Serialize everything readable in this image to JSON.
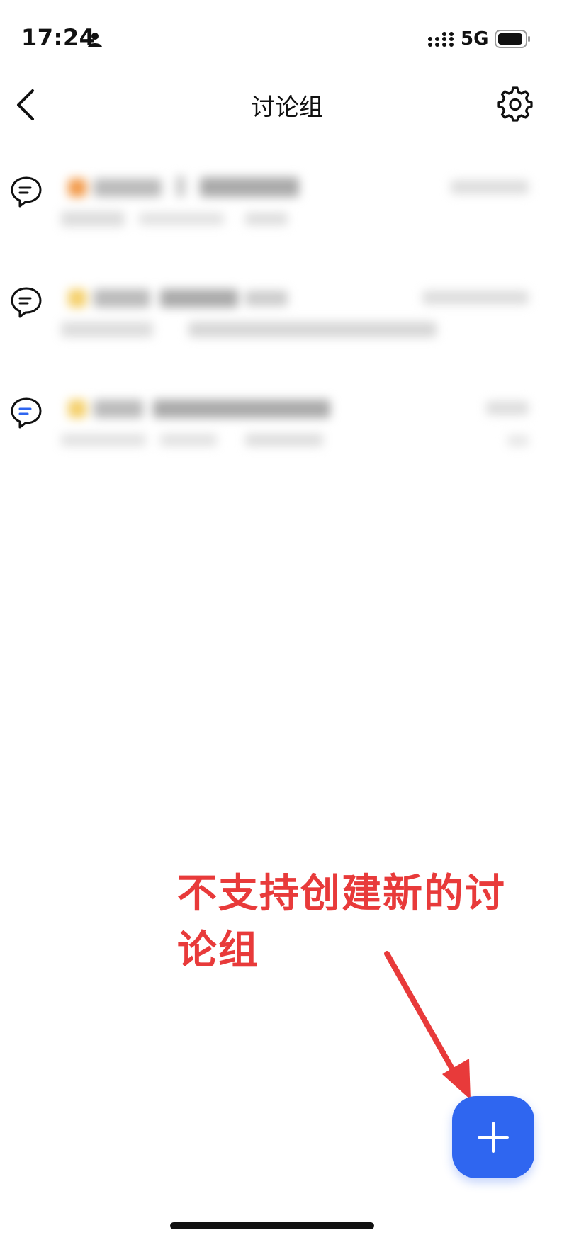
{
  "status_bar": {
    "time": "17:24",
    "network": "5G",
    "icons": [
      "person-icon",
      "signal-icon",
      "battery-icon"
    ]
  },
  "nav": {
    "title": "讨论组",
    "back_icon": "chevron-left-icon",
    "settings_icon": "gear-icon"
  },
  "discussions": [
    {
      "icon": "chat-bubble-icon",
      "accent": "#f29a4a",
      "title": "",
      "time": "",
      "preview": ""
    },
    {
      "icon": "chat-bubble-icon",
      "accent": "#f4cf6a",
      "title": "",
      "time": "",
      "preview": ""
    },
    {
      "icon": "chat-bubble-active-icon",
      "accent": "#f4cf6a",
      "title": "",
      "time": "",
      "preview": ""
    }
  ],
  "annotation": {
    "text": "不支持创建新的讨论组",
    "color": "#e83a3a"
  },
  "fab": {
    "icon": "plus-icon",
    "color": "#2f66f0"
  }
}
